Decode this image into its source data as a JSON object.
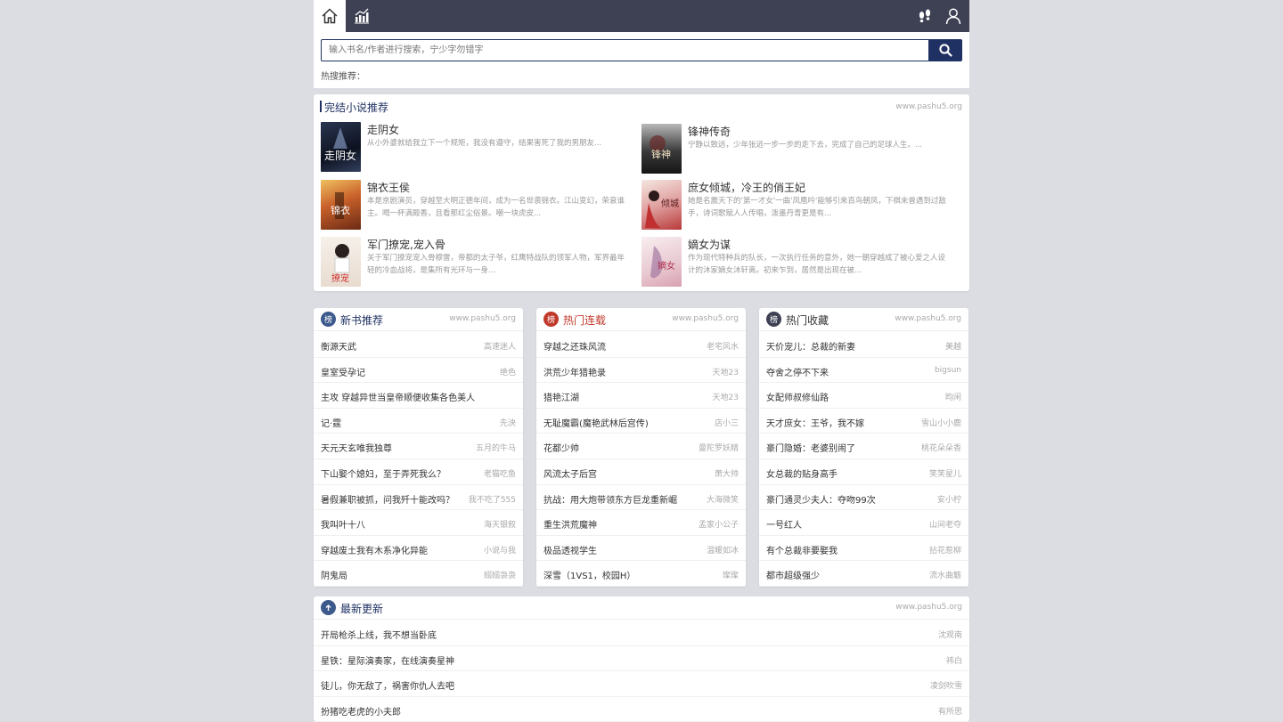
{
  "nav": {
    "home_icon": "home-icon",
    "rank_icon": "bar-chart-icon",
    "footprint_icon": "footprints-icon",
    "user_icon": "user-icon"
  },
  "search": {
    "placeholder": "输入书名/作者进行搜索，宁少字勿错字",
    "button_icon": "search-icon"
  },
  "hot_search": {
    "label": "热搜推荐："
  },
  "featured": {
    "title": "完结小说推荐",
    "site": "www.pashu5.org",
    "books": [
      {
        "title": "走阴女",
        "desc": "从小外婆就给我立下一个规矩，我没有遵守，结果害死了我的男朋友..."
      },
      {
        "title": "锋神传奇",
        "desc": "宁静以致远，少年张远一步一步的走下去，完成了自己的足球人生。..."
      },
      {
        "title": "锦衣王侯",
        "desc": "本是京剧演员，穿越至大明正德年间，成为一名世袭锦衣。江山变幻，荣衰谁主。喝一杯满殿香，且看那红尘俗景。嘲一块虎皮..."
      },
      {
        "title": "庶女倾城，冷王的俏王妃",
        "desc": "她是名震天下的'第一才女'一曲'凤凰吟'能够引来百鸟朝凤，下棋未曾遇到过敌手，诗词歌赋人人传唱，泼墨丹青更是有..."
      },
      {
        "title": "军门撩宠,宠入骨",
        "desc": "关于军门撩宠宠入骨穆雷，帝都的太子爷，红鹰特战队的领军人物，军界最年轻的冷血战将，是集所有光环与一身..."
      },
      {
        "title": "嫡女为谋",
        "desc": "作为现代特种兵的队长，一次执行任务的意外，她一朝穿越成了被心爱之人设计的沐家嫡女沐轩离。初来乍到，居然是出现在被..."
      }
    ]
  },
  "columns": [
    {
      "title": "新书推荐",
      "site": "www.pashu5.org",
      "badge": "榜",
      "color": "#1f3163",
      "badge_color": "#3d5a8c",
      "items": [
        {
          "name": "衡源天武",
          "author": "高速迷人"
        },
        {
          "name": "皇室受孕记",
          "author": "绝色"
        },
        {
          "name": "主攻 穿越异世当皇帝顺便收集各色美人",
          "author": ""
        },
        {
          "name": "记·霆",
          "author": "先泱"
        },
        {
          "name": "天元天玄唯我独尊",
          "author": "五月的牛马"
        },
        {
          "name": "下山娶个媳妇，至于弄死我么？",
          "author": "老猫吃鱼"
        },
        {
          "name": "暑假兼职被抓，问我歼十能改吗？",
          "author": "我不吃了555"
        },
        {
          "name": "我叫叶十八",
          "author": "海天银叙"
        },
        {
          "name": "穿越废土我有木系净化异能",
          "author": "小说与我"
        },
        {
          "name": "阴鬼局",
          "author": "嫋嫋袅袅"
        }
      ]
    },
    {
      "title": "热门连载",
      "site": "www.pashu5.org",
      "badge": "榜",
      "color": "#c0392b",
      "badge_color": "#c0392b",
      "items": [
        {
          "name": "穿越之还珠风流",
          "author": "老宅风水"
        },
        {
          "name": "洪荒少年猎艳录",
          "author": "天地23"
        },
        {
          "name": "猎艳江湖",
          "author": "天地23"
        },
        {
          "name": "无耻魔霸(魔艳武林后宫传)",
          "author": "店小三"
        },
        {
          "name": "花都少帅",
          "author": "曼陀罗妖精"
        },
        {
          "name": "风流太子后宫",
          "author": "萧大帅"
        },
        {
          "name": "抗战：用大炮带领东方巨龙重新崛",
          "author": "大海微笑"
        },
        {
          "name": "重生洪荒魔神",
          "author": "孟家小公子"
        },
        {
          "name": "极品透视学生",
          "author": "温暖如冰"
        },
        {
          "name": "深雪（1VS1，校园H）",
          "author": "璨璨"
        }
      ]
    },
    {
      "title": "热门收藏",
      "site": "www.pashu5.org",
      "badge": "榜",
      "color": "#1f3163",
      "badge_color": "#3d4153",
      "items": [
        {
          "name": "天价宠儿：总裁的新妻",
          "author": "美越"
        },
        {
          "name": "夺舍之停不下来",
          "author": "bigsun"
        },
        {
          "name": "女配师叔修仙路",
          "author": "昀闲"
        },
        {
          "name": "天才庶女：王爷，我不嫁",
          "author": "雪山小小鹿"
        },
        {
          "name": "豪门隐婚：老婆别闹了",
          "author": "桃花朵朵香"
        },
        {
          "name": "女总裁的贴身高手",
          "author": "笑笑星儿"
        },
        {
          "name": "豪门通灵少夫人：夺吻99次",
          "author": "安小柠"
        },
        {
          "name": "一号红人",
          "author": "山间老夺"
        },
        {
          "name": "有个总裁非要娶我",
          "author": "拈花惹柳"
        },
        {
          "name": "都市超级强少",
          "author": "流水曲觞"
        }
      ]
    }
  ],
  "latest": {
    "title": "最新更新",
    "site": "www.pashu5.org",
    "items": [
      {
        "name": "开局枪杀上线，我不想当卧底",
        "author": "沈观南"
      },
      {
        "name": "星铁：星际演奏家，在线演奏星神",
        "author": "祎白"
      },
      {
        "name": "徒儿，你无敌了，祸害你仇人去吧",
        "author": "凌剑吹雪"
      },
      {
        "name": "扮猪吃老虎的小夫郎",
        "author": "有所思"
      }
    ]
  }
}
